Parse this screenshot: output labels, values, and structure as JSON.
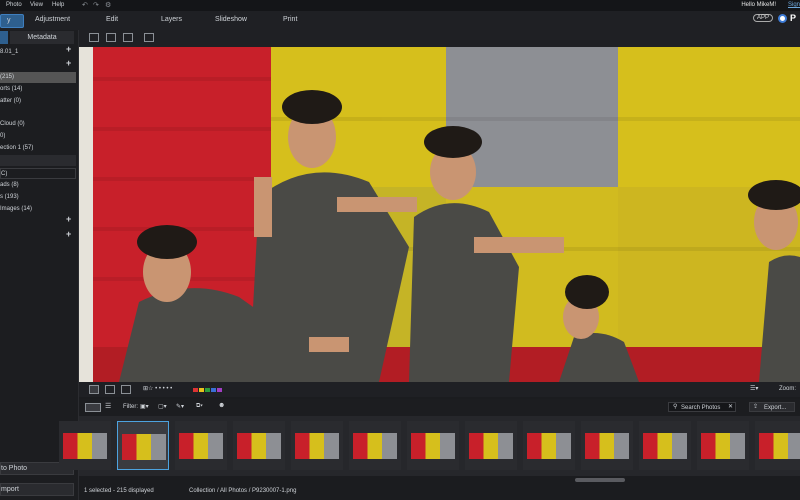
{
  "menubar": {
    "items": [
      "Photo",
      "View",
      "Help"
    ],
    "greeting": "Hello MikeM!",
    "signin": "Sign"
  },
  "modes": {
    "active": "y",
    "tabs": [
      "Adjustment",
      "Edit",
      "Layers",
      "Slideshow",
      "Print"
    ],
    "app_badge": "APP",
    "product": "P"
  },
  "left_panel": {
    "tab_folders": "",
    "tab_metadata": "Metadata",
    "catalog_name": "8.01_1",
    "rows": [
      "(215)",
      "orts (14)",
      "atter (0)",
      "",
      "Cloud (0)",
      "0)",
      "ection 1 (57)"
    ],
    "section2": "C)",
    "rows2": [
      "ads (8)",
      "s (193)",
      "Images (14)"
    ],
    "btn_goto": "to Photo",
    "btn_import": "mport"
  },
  "filmstrip": {
    "filter_label": "Filter:",
    "search_placeholder": "Search Photos",
    "export_label": "Export...",
    "zoom_label": "Zoom:",
    "thumb_count": 13,
    "selected_index": 1
  },
  "status": {
    "selected": "1 selected - 215 displayed",
    "path": "Collection / All Photos / P9230007-1.png"
  },
  "colors": {
    "accent": "#2e5f8e",
    "selection": "#4da3e0",
    "wall_red": "#c8202a",
    "wall_yellow": "#d6bf1c",
    "wall_gray": "#8d8f94"
  }
}
